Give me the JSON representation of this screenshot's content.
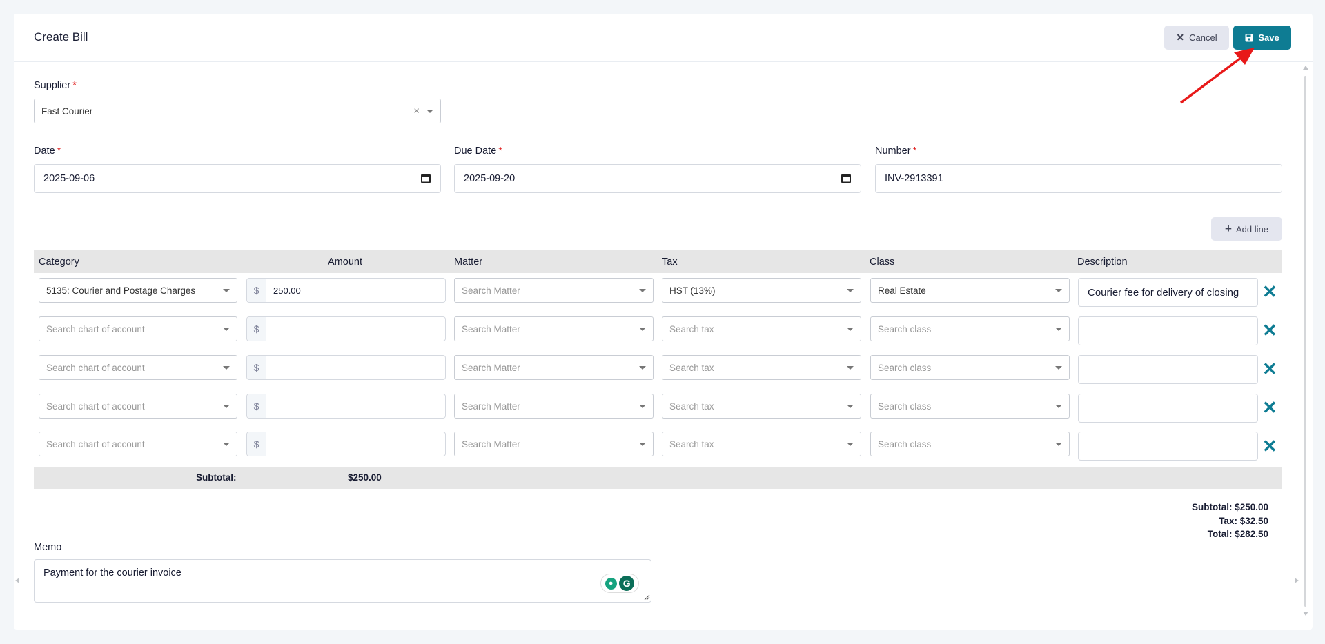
{
  "page": {
    "title": "Create Bill",
    "cancel_label": "Cancel",
    "save_label": "Save"
  },
  "supplier": {
    "label": "Supplier",
    "value": "Fast Courier"
  },
  "date": {
    "label": "Date",
    "value": "2025-09-06"
  },
  "due_date": {
    "label": "Due Date",
    "value": "2025-09-20"
  },
  "number": {
    "label": "Number",
    "value": "INV-2913391"
  },
  "add_line_label": "Add line",
  "table": {
    "headers": {
      "category": "Category",
      "amount": "Amount",
      "matter": "Matter",
      "tax": "Tax",
      "class": "Class",
      "description": "Description"
    },
    "currency_symbol": "$",
    "rows": [
      {
        "category": "5135: Courier and Postage Charges",
        "amount": "250.00",
        "matter": "Search Matter",
        "tax": "HST (13%)",
        "class": "Real Estate",
        "description": "Courier fee for delivery of closing"
      },
      {
        "category": "Search chart of account",
        "amount": "",
        "matter": "Search Matter",
        "tax": "Search tax",
        "class": "Search class",
        "description": ""
      },
      {
        "category": "Search chart of account",
        "amount": "",
        "matter": "Search Matter",
        "tax": "Search tax",
        "class": "Search class",
        "description": ""
      },
      {
        "category": "Search chart of account",
        "amount": "",
        "matter": "Search Matter",
        "tax": "Search tax",
        "class": "Search class",
        "description": ""
      },
      {
        "category": "Search chart of account",
        "amount": "",
        "matter": "Search Matter",
        "tax": "Search tax",
        "class": "Search class",
        "description": ""
      }
    ],
    "subtotal_label": "Subtotal:",
    "subtotal_value": "$250.00"
  },
  "totals": {
    "subtotal": "Subtotal: $250.00",
    "tax": "Tax: $32.50",
    "total": "Total: $282.50"
  },
  "memo": {
    "label": "Memo",
    "value": "Payment for the courier invoice"
  },
  "colors": {
    "primary": "#0e7c93",
    "required": "#e02020",
    "annotation_arrow": "#e81919"
  }
}
